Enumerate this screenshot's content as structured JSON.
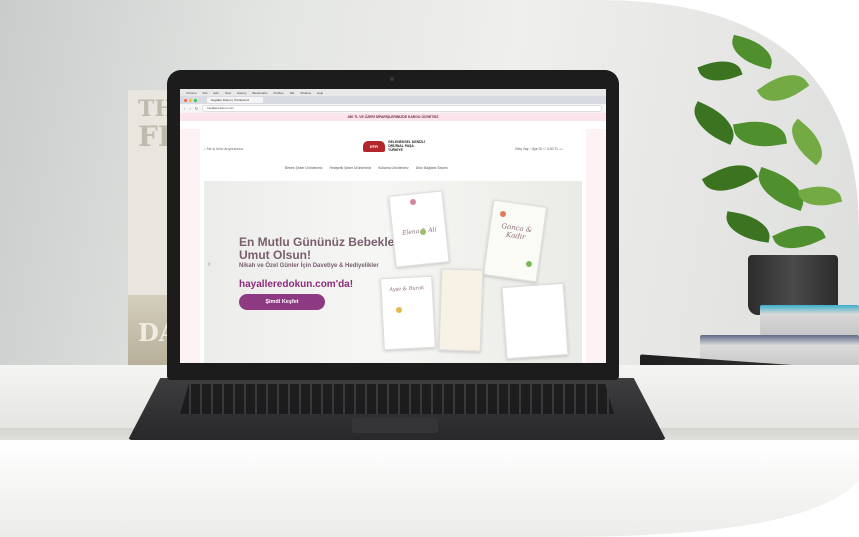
{
  "scene": {
    "book_cover": {
      "title_lines": [
        "TH",
        "FI"
      ],
      "bottom_text": "DA"
    }
  },
  "browser": {
    "menu_bar": [
      "Chrome",
      "File",
      "Edit",
      "View",
      "History",
      "Bookmarks",
      "Profiles",
      "Tab",
      "Window",
      "Help"
    ],
    "tab_title": "Hayaller Dokun | Ürünlerimiz",
    "url": "hayalleredokun.com"
  },
  "site": {
    "promo_banner": "450 TL VE ÜZERİ SİPARİŞLERİNİZDE KARGO ÜCRETSİZ",
    "search_placeholder": "Ne iç ürün arıyorsunuz",
    "logo_mark": "EFR",
    "logo_lines": [
      "GELENEKSEL DENİZLİ",
      "ORİJİNAL PAŞA",
      "TÜRKİYE"
    ],
    "account_text": "Giriş Yap · Üye Ol",
    "cart_text": "0,00 TL",
    "menu": [
      "Bebek Şeker Ürünlerimiz",
      "Hediyelik Şeker Ürünlerimiz",
      "Kutlama Ürünlerimiz",
      "Ürün Bağlantı Seçimi"
    ],
    "hero": {
      "title": "En Mutlu Gününüz Bebeklere Umut Olsun!",
      "subtitle": "Nikah ve Özel Günler İçin Davetiye & Hediyelikler",
      "brand": "hayalleredokun.com'da!",
      "button": "Şimdi Keşfet"
    },
    "cards": [
      "Elena & Ali",
      "Gonca & Kadir",
      "Ayşe & Burak"
    ]
  },
  "colors": {
    "accent": "#8e3a83",
    "promo_bg": "#fce4ec",
    "logo_red": "#b3262d"
  }
}
